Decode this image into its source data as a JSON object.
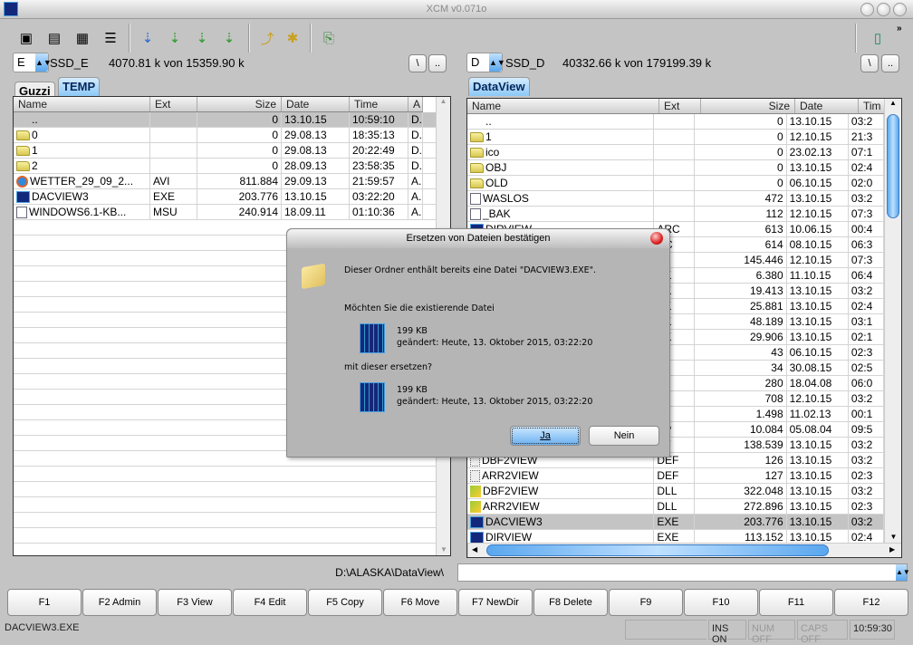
{
  "window": {
    "title": "XCM v0.071o",
    "icon": "app-icon"
  },
  "toolbar": {
    "buttons": [
      "view-brief-icon",
      "view-detail-icon",
      "view-icons-icon",
      "view-list-icon",
      "sort-name-icon",
      "sort-type-icon",
      "sort-size-icon",
      "sort-date-icon",
      "parent-folder-icon",
      "new-folder-icon",
      "copy-files-icon"
    ],
    "right": "exit-door-icon",
    "overflow": "»"
  },
  "left": {
    "drive": "E",
    "drive_label": "SSD_E",
    "space": "4070.81 k von 15359.90 k",
    "root_btn": "\\",
    "up_btn": "..",
    "tabs": [
      {
        "label": "Guzzi",
        "active": false
      },
      {
        "label": "TEMP",
        "active": true
      }
    ],
    "columns": [
      "Name",
      "Ext",
      "Size",
      "Date",
      "Time",
      "A"
    ],
    "rows": [
      {
        "icon": "none",
        "name": "..",
        "ext": "",
        "size": "0",
        "date": "13.10.15",
        "time": "10:59:10",
        "attr": "D.",
        "selected": true
      },
      {
        "icon": "folder",
        "name": "0",
        "ext": "",
        "size": "0",
        "date": "29.08.13",
        "time": "18:35:13",
        "attr": "D."
      },
      {
        "icon": "folder",
        "name": "1",
        "ext": "",
        "size": "0",
        "date": "29.08.13",
        "time": "20:22:49",
        "attr": "D."
      },
      {
        "icon": "folder",
        "name": "2",
        "ext": "",
        "size": "0",
        "date": "28.09.13",
        "time": "23:58:35",
        "attr": "D."
      },
      {
        "icon": "avi",
        "name": "WETTER_29_09_2...",
        "ext": "AVI",
        "size": "811.884",
        "date": "29.09.13",
        "time": "21:59:57",
        "attr": "A."
      },
      {
        "icon": "exe",
        "name": "DACVIEW3",
        "ext": "EXE",
        "size": "203.776",
        "date": "13.10.15",
        "time": "03:22:20",
        "attr": "A."
      },
      {
        "icon": "doc",
        "name": "WINDOWS6.1-KB...",
        "ext": "MSU",
        "size": "240.914",
        "date": "18.09.11",
        "time": "01:10:36",
        "attr": "A."
      }
    ]
  },
  "right": {
    "drive": "D",
    "drive_label": "SSD_D",
    "space": "40332.66 k von 179199.39 k",
    "root_btn": "\\",
    "up_btn": "..",
    "tabs": [
      {
        "label": "DataView",
        "active": true
      }
    ],
    "columns": [
      "Name",
      "Ext",
      "Size",
      "Date",
      "Tim"
    ],
    "rows": [
      {
        "icon": "none",
        "name": "..",
        "ext": "",
        "size": "0",
        "date": "13.10.15",
        "time": "03:2"
      },
      {
        "icon": "folder",
        "name": "1",
        "ext": "",
        "size": "0",
        "date": "12.10.15",
        "time": "21:3"
      },
      {
        "icon": "folder",
        "name": "ico",
        "ext": "",
        "size": "0",
        "date": "23.02.13",
        "time": "07:1"
      },
      {
        "icon": "folder",
        "name": "OBJ",
        "ext": "",
        "size": "0",
        "date": "13.10.15",
        "time": "02:4"
      },
      {
        "icon": "folder",
        "name": "OLD",
        "ext": "",
        "size": "0",
        "date": "06.10.15",
        "time": "02:0"
      },
      {
        "icon": "doc",
        "name": "WASLOS",
        "ext": "",
        "size": "472",
        "date": "13.10.15",
        "time": "03:2"
      },
      {
        "icon": "doc",
        "name": "_BAK",
        "ext": "",
        "size": "112",
        "date": "12.10.15",
        "time": "07:3"
      },
      {
        "icon": "exe",
        "name": "DIRVIEW",
        "ext": "ARC",
        "size": "613",
        "date": "10.06.15",
        "time": "00:4"
      },
      {
        "icon": "none",
        "name": "",
        "ext": "RC",
        "size": "614",
        "date": "08.10.15",
        "time": "06:3"
      },
      {
        "icon": "none",
        "name": "",
        "ext": "RJ",
        "size": "145.446",
        "date": "12.10.15",
        "time": "07:3"
      },
      {
        "icon": "none",
        "name": "",
        "ext": "AK",
        "size": "6.380",
        "date": "11.10.15",
        "time": "06:4"
      },
      {
        "icon": "none",
        "name": "",
        "ext": "AK",
        "size": "19.413",
        "date": "13.10.15",
        "time": "03:2"
      },
      {
        "icon": "none",
        "name": "",
        "ext": "AK",
        "size": "25.881",
        "date": "13.10.15",
        "time": "02:4"
      },
      {
        "icon": "none",
        "name": "",
        "ext": "AK",
        "size": "48.189",
        "date": "13.10.15",
        "time": "03:1"
      },
      {
        "icon": "none",
        "name": "",
        "ext": "AK",
        "size": "29.906",
        "date": "13.10.15",
        "time": "02:1"
      },
      {
        "icon": "none",
        "name": "",
        "ext": "AT",
        "size": "43",
        "date": "06.10.15",
        "time": "02:3"
      },
      {
        "icon": "none",
        "name": "",
        "ext": "AT",
        "size": "34",
        "date": "30.08.15",
        "time": "02:5"
      },
      {
        "icon": "none",
        "name": "",
        "ext": "AT",
        "size": "280",
        "date": "18.04.08",
        "time": "06:0"
      },
      {
        "icon": "none",
        "name": "",
        "ext": "H",
        "size": "708",
        "date": "12.10.15",
        "time": "03:2"
      },
      {
        "icon": "none",
        "name": "",
        "ext": "H",
        "size": "1.498",
        "date": "11.02.13",
        "time": "00:1"
      },
      {
        "icon": "none",
        "name": "",
        "ext": "PP",
        "size": "10.084",
        "date": "05.08.04",
        "time": "09:5"
      },
      {
        "icon": "none",
        "name": "",
        "ext": "BF",
        "size": "138.539",
        "date": "13.10.15",
        "time": "03:2"
      },
      {
        "icon": "def",
        "name": "DBF2VIEW",
        "ext": "DEF",
        "size": "126",
        "date": "13.10.15",
        "time": "03:2"
      },
      {
        "icon": "def",
        "name": "ARR2VIEW",
        "ext": "DEF",
        "size": "127",
        "date": "13.10.15",
        "time": "02:3"
      },
      {
        "icon": "dll",
        "name": "DBF2VIEW",
        "ext": "DLL",
        "size": "322.048",
        "date": "13.10.15",
        "time": "03:2"
      },
      {
        "icon": "dll",
        "name": "ARR2VIEW",
        "ext": "DLL",
        "size": "272.896",
        "date": "13.10.15",
        "time": "02:3"
      },
      {
        "icon": "exe",
        "name": "DACVIEW3",
        "ext": "EXE",
        "size": "203.776",
        "date": "13.10.15",
        "time": "03:2",
        "selected": true
      },
      {
        "icon": "exe",
        "name": "DIRVIEW",
        "ext": "EXE",
        "size": "113.152",
        "date": "13.10.15",
        "time": "02:4"
      }
    ]
  },
  "path": {
    "current": "D:\\ALASKA\\DataView\\",
    "command_value": ""
  },
  "fkeys": [
    "F1",
    "F2 Admin",
    "F3 View",
    "F4 Edit",
    "F5 Copy",
    "F6 Move",
    "F7 NewDir",
    "F8 Delete",
    "F9",
    "F10",
    "F11",
    "F12"
  ],
  "status": {
    "file": "DACVIEW3.EXE",
    "ins": "INS ON",
    "num": "NUM OFF",
    "caps": "CAPS OFF",
    "clock": "10:59:30"
  },
  "dialog": {
    "title": "Ersetzen von Dateien bestätigen",
    "message": "Dieser Ordner enthält bereits eine Datei \"DACVIEW3.EXE\".",
    "question1": "Möchten Sie die existierende Datei",
    "existing": {
      "size": "199 KB",
      "modified": "geändert: Heute, 13. Oktober 2015, 03:22:20"
    },
    "question2": "mit dieser ersetzen?",
    "new": {
      "size": "199 KB",
      "modified": "geändert: Heute, 13. Oktober 2015, 03:22:20"
    },
    "yes": "Ja",
    "no": "Nein"
  },
  "colors": {
    "accent": "#5aa7ee",
    "selection": "#c4c4c4",
    "exe_icon": "#13287a"
  }
}
